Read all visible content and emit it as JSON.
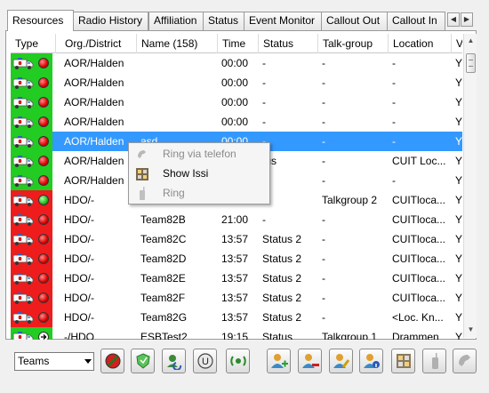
{
  "tabs": [
    "Resources",
    "Radio History",
    "Affiliation",
    "Status",
    "Event Monitor",
    "Callout Out",
    "Callout In"
  ],
  "tab_scroll": {
    "left_icon": "chevron-left-icon",
    "right_icon": "chevron-right-icon"
  },
  "columns": [
    "Type",
    "Org./District",
    "Name (158)",
    "Time",
    "Status",
    "Talk-group",
    "Location",
    "V"
  ],
  "rows": [
    {
      "color": "green",
      "dot": "red",
      "org": "AOR/Halden",
      "name": "",
      "time": "00:00",
      "status": "-",
      "talkgroup": "-",
      "location": "-",
      "v": "Y"
    },
    {
      "color": "green",
      "dot": "red",
      "org": "AOR/Halden",
      "name": "",
      "time": "00:00",
      "status": "-",
      "talkgroup": "-",
      "location": "-",
      "v": "Y"
    },
    {
      "color": "green",
      "dot": "red",
      "org": "AOR/Halden",
      "name": "",
      "time": "00:00",
      "status": "-",
      "talkgroup": "-",
      "location": "-",
      "v": "Y"
    },
    {
      "color": "green",
      "dot": "red",
      "org": "AOR/Halden",
      "name": "",
      "time": "00:00",
      "status": "-",
      "talkgroup": "-",
      "location": "-",
      "v": "Y"
    },
    {
      "color": "green",
      "dot": "red",
      "org": "AOR/Halden",
      "name": "asd",
      "time": "00:00",
      "status": "-",
      "talkgroup": "-",
      "location": "-",
      "v": "Y",
      "selected": true
    },
    {
      "color": "green",
      "dot": "red",
      "org": "AOR/Halden",
      "name": "",
      "time": "",
      "status": "tus",
      "talkgroup": "-",
      "location": "CUIT Loc...",
      "v": "Y"
    },
    {
      "color": "green",
      "dot": "red",
      "org": "AOR/Halden",
      "name": "",
      "time": "",
      "status": "",
      "talkgroup": "-",
      "location": "-",
      "v": "Y"
    },
    {
      "color": "red",
      "dot": "green",
      "org": "HDO/-",
      "name": "",
      "time": "",
      "status": "",
      "talkgroup": "Talkgroup 2",
      "location": "CUITloca...",
      "v": "Y"
    },
    {
      "color": "red",
      "dot": "red",
      "org": "HDO/-",
      "name": "Team82B",
      "time": "21:00",
      "status": "-",
      "talkgroup": "-",
      "location": "CUITloca...",
      "v": "Y"
    },
    {
      "color": "red",
      "dot": "red",
      "org": "HDO/-",
      "name": "Team82C",
      "time": "13:57",
      "status": "Status 2",
      "talkgroup": "-",
      "location": "CUITloca...",
      "v": "Y"
    },
    {
      "color": "red",
      "dot": "red",
      "org": "HDO/-",
      "name": "Team82D",
      "time": "13:57",
      "status": "Status 2",
      "talkgroup": "-",
      "location": "CUITloca...",
      "v": "Y"
    },
    {
      "color": "red",
      "dot": "red",
      "org": "HDO/-",
      "name": "Team82E",
      "time": "13:57",
      "status": "Status 2",
      "talkgroup": "-",
      "location": "CUITloca...",
      "v": "Y"
    },
    {
      "color": "red",
      "dot": "red",
      "org": "HDO/-",
      "name": "Team82F",
      "time": "13:57",
      "status": "Status 2",
      "talkgroup": "-",
      "location": "CUITloca...",
      "v": "Y"
    },
    {
      "color": "red",
      "dot": "red",
      "org": "HDO/-",
      "name": "Team82G",
      "time": "13:57",
      "status": "Status 2",
      "talkgroup": "-",
      "location": "<Loc. Kn...",
      "v": "Y"
    },
    {
      "color": "green",
      "dot": "arrow",
      "org": "-/HDO",
      "name": "ESBTest2",
      "time": "19:15",
      "status": "Status",
      "talkgroup": "Talkgroup 1",
      "location": "Drammen",
      "v": "Y"
    }
  ],
  "context_menu": [
    {
      "label": "Ring via telefon",
      "enabled": false,
      "icon": "phone-handset-icon"
    },
    {
      "label": "Show Issi",
      "enabled": true,
      "icon": "id-card-icon"
    },
    {
      "label": "Ring",
      "enabled": false,
      "icon": "radio-handset-icon"
    }
  ],
  "toolbar": {
    "filter_value": "Teams",
    "buttons": [
      "stop-icon",
      "shield-icon",
      "refresh-user-icon",
      "u-letter-icon",
      "broadcast-icon",
      "add-user-icon",
      "remove-user-icon",
      "edit-user-icon",
      "user-info-icon",
      "columns-icon",
      "radio-icon",
      "phone-icon"
    ]
  },
  "colors": {
    "selection": "#3399ff",
    "green_type": "#22cc22",
    "red_type": "#ee1c1c"
  }
}
